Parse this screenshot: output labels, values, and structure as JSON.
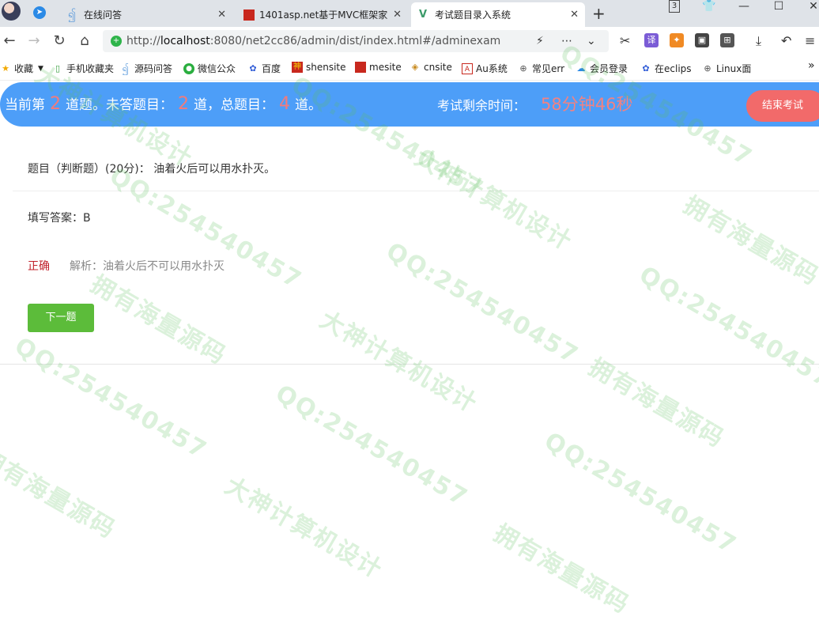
{
  "browser": {
    "tabs": [
      {
        "title": "在线问答",
        "active": false
      },
      {
        "title": "1401asp.net基于MVC框架家",
        "active": false
      },
      {
        "title": "考试题目录入系统",
        "active": true
      }
    ],
    "url_prefix": "http://",
    "url_host": "localhost",
    "url_rest": ":8080/net2cc86/admin/dist/index.html#/adminexam",
    "tab_count_badge": "3",
    "bookmarks": [
      {
        "label": "收藏",
        "icon": "star-icon"
      },
      {
        "label": "手机收藏夹",
        "icon": "phone-icon"
      },
      {
        "label": "源码问答",
        "icon": "swirl-icon"
      },
      {
        "label": "微信公众",
        "icon": "wechat-icon"
      },
      {
        "label": "百度",
        "icon": "baidu-paw-icon"
      },
      {
        "label": "shensite",
        "icon": "shen-icon"
      },
      {
        "label": "mesite",
        "icon": "red-square-icon"
      },
      {
        "label": "cnsite",
        "icon": "layers-icon"
      },
      {
        "label": "Au系统",
        "icon": "au-icon"
      },
      {
        "label": "常见err",
        "icon": "globe-icon"
      },
      {
        "label": "会员登录",
        "icon": "cloud-icon"
      },
      {
        "label": "在eclips",
        "icon": "baidu-paw-icon"
      },
      {
        "label": "Linux面",
        "icon": "globe-icon"
      }
    ]
  },
  "exam": {
    "progress_prefix": "当前第",
    "current_index": "2",
    "progress_mid1": "道题。未答题目：",
    "unanswered": "2",
    "progress_mid2": "道，总题目：",
    "total": "4",
    "progress_suffix": "道。",
    "time_label": "考试剩余时间：",
    "time_remaining": "58分钟46秒",
    "end_button": "结束考试"
  },
  "question": {
    "text": "题目（判断题）(20分)：  油着火后可以用水扑灭。",
    "answer": "填写答案：B",
    "result": "正确",
    "analysis": "解析：油着火后不可以用水扑灭",
    "next_button": "下一题"
  },
  "watermark": {
    "lines": [
      "大神计算机设计",
      "QQ:254540457",
      "拥有海量源码"
    ]
  }
}
